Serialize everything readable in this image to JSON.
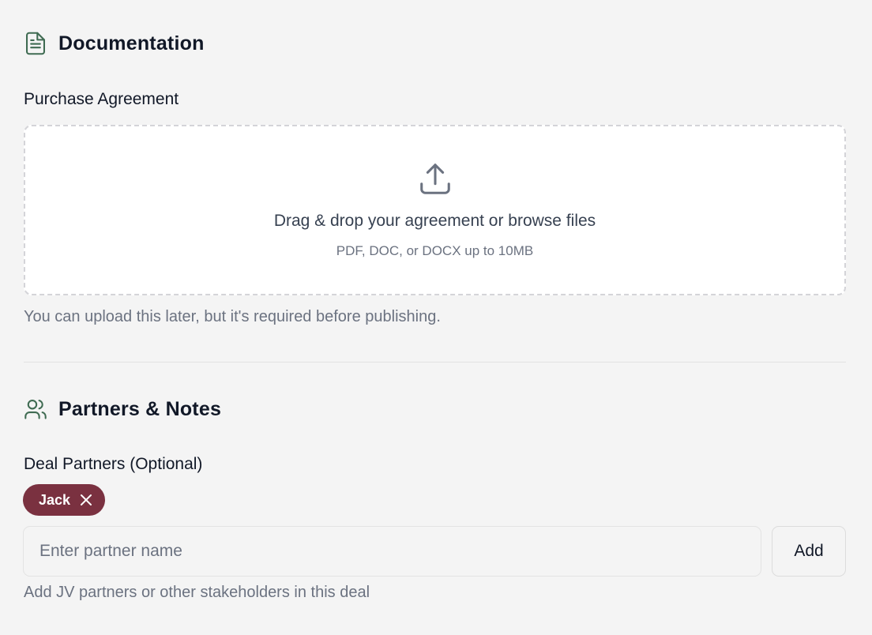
{
  "documentation": {
    "title": "Documentation",
    "icon": "document-icon",
    "purchase_agreement_label": "Purchase Agreement",
    "dropzone": {
      "icon": "upload-icon",
      "title": "Drag & drop your agreement or browse files",
      "subtitle": "PDF, DOC, or DOCX up to 10MB"
    },
    "helper_text": "You can upload this later, but it's required before publishing."
  },
  "partners": {
    "title": "Partners & Notes",
    "icon": "users-icon",
    "deal_partners_label": "Deal Partners (Optional)",
    "chips": [
      {
        "label": "Jack"
      }
    ],
    "input": {
      "value": "",
      "placeholder": "Enter partner name"
    },
    "add_button_label": "Add",
    "helper_text": "Add JV partners or other stakeholders in this deal"
  },
  "colors": {
    "accent_green": "#3f6b52",
    "chip_background": "#7a3140",
    "page_background": "#f4f4f4"
  }
}
